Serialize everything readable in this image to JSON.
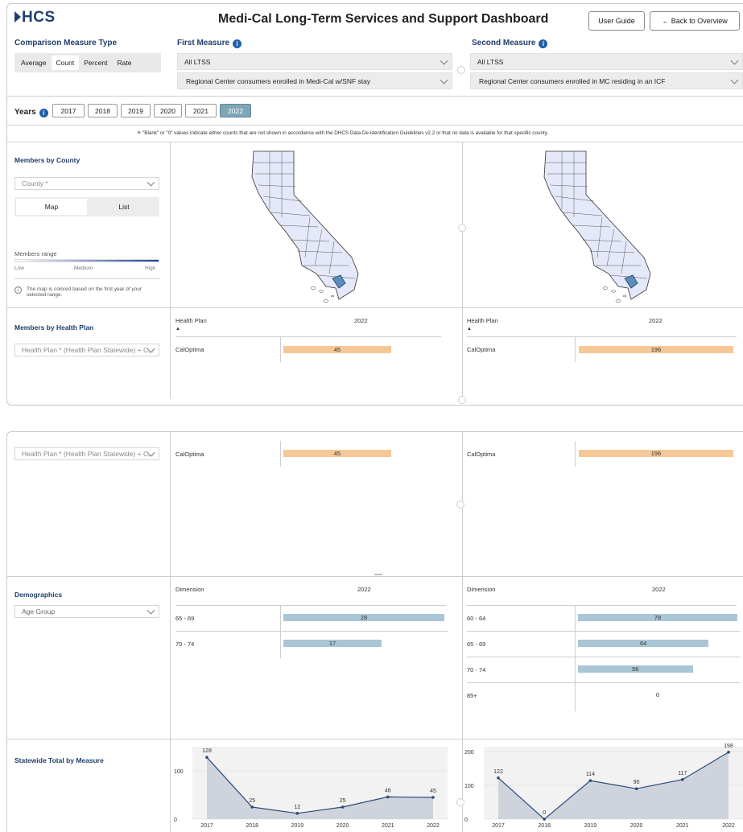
{
  "header": {
    "logo": "HCS",
    "title": "Medi-Cal Long-Term Services and Support Dashboard",
    "user_guide": "User Guide",
    "back": "← Back to Overview"
  },
  "comparison": {
    "label": "Comparison Measure Type",
    "options": [
      "Average",
      "Count",
      "Percent",
      "Rate"
    ]
  },
  "first_measure": {
    "label": "First Measure",
    "category": "All LTSS",
    "measure": "Regional Center consumers enrolled in Medi-Cal w/SNF stay"
  },
  "second_measure": {
    "label": "Second Measure",
    "category": "All LTSS",
    "measure": "Regional Center consumers enrolled in MC residing in an ICF"
  },
  "years": {
    "label": "Years",
    "options": [
      "2017",
      "2018",
      "2019",
      "2020",
      "2021",
      "2022"
    ],
    "selected": "2022"
  },
  "note": "\"Blank\" or \"0\" values indicate either counts that are not shown in accordance with the DHCS Data De-identification Guidelines v2.2 or that no data is available for that specific county.",
  "county": {
    "title": "Members by County",
    "placeholder": "County *",
    "toggle": [
      "Map",
      "List"
    ],
    "range_label": "Members range",
    "range_low": "Low",
    "range_mid": "Medium",
    "range_high": "High",
    "footnote": "The map is colored based on the first year of your selected range."
  },
  "health_plan": {
    "title": "Members by Health Plan",
    "filter": "Health Plan * (Health Plan Statewide) + C...",
    "col_plan": "Health Plan",
    "col_year": "2022",
    "left": [
      {
        "plan": "CalOptima",
        "value": "45",
        "fraction": 0.69
      }
    ],
    "right": [
      {
        "plan": "CalOptima",
        "value": "196",
        "fraction": 1.0
      }
    ]
  },
  "demographics": {
    "title": "Demographics",
    "filter": "Age Group",
    "col_dim": "Dimension",
    "col_year": "2022",
    "left": [
      {
        "label": "65 - 69",
        "value": "28",
        "fraction": 1.0
      },
      {
        "label": "70 - 74",
        "value": "17",
        "fraction": 0.61
      }
    ],
    "right": [
      {
        "label": "60 - 64",
        "value": "78",
        "fraction": 1.0
      },
      {
        "label": "65 - 69",
        "value": "64",
        "fraction": 0.82
      },
      {
        "label": "70 - 74",
        "value": "56",
        "fraction": 0.72
      },
      {
        "label": "85+",
        "value": "0",
        "fraction": 0
      }
    ]
  },
  "statewide": {
    "title": "Statewide Total by Measure"
  },
  "colors": {
    "accent": "#1f3d6b",
    "orange_bar": "#f7c897",
    "blue_bar": "#a9c6d6",
    "year_selected": "#7ea6b8",
    "map_fill": "#e4e8f8",
    "map_highlight": "#5b8fb9"
  },
  "chart_data": [
    {
      "type": "area",
      "x": [
        "2017",
        "2018",
        "2019",
        "2020",
        "2021",
        "2022"
      ],
      "values": [
        128,
        25,
        12,
        25,
        46,
        45
      ],
      "yticks": [
        0,
        100
      ],
      "ylim": [
        0,
        140
      ]
    },
    {
      "type": "area",
      "x": [
        "2017",
        "2018",
        "2019",
        "2020",
        "2021",
        "2022"
      ],
      "values": [
        122,
        0,
        114,
        90,
        117,
        198
      ],
      "yticks": [
        0,
        100,
        200
      ],
      "ylim": [
        0,
        200
      ]
    }
  ]
}
